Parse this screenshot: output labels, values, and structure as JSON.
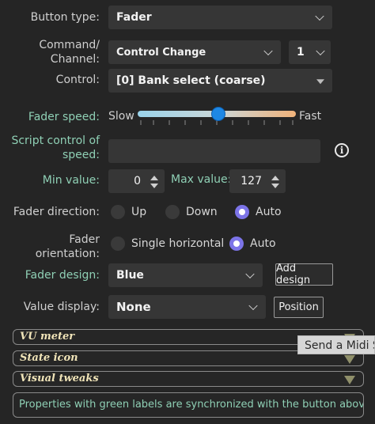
{
  "button_type": {
    "label": "Button type:",
    "value": "Fader"
  },
  "command_channel": {
    "label_line1": "Command/",
    "label_line2": "Channel:",
    "command": "Control Change",
    "channel": "1"
  },
  "control": {
    "label": "Control:",
    "value": "[0] Bank select (coarse)"
  },
  "fader_speed": {
    "label": "Fader speed:",
    "slow": "Slow",
    "fast": "Fast",
    "level": 0.51
  },
  "script_control": {
    "label_line1": "Script control of",
    "label_line2": "speed:",
    "value": "",
    "info_icon": "info-icon"
  },
  "min_value": {
    "label": "Min value:",
    "value": "0"
  },
  "max_value": {
    "label": "Max value:",
    "value": "127"
  },
  "fader_direction": {
    "label": "Fader direction:",
    "options": [
      "Up",
      "Down",
      "Auto"
    ],
    "selected": "Auto"
  },
  "fader_orientation": {
    "label_line1": "Fader",
    "label_line2": "orientation:",
    "options": [
      "Single horizontal",
      "Auto"
    ],
    "selected": "Auto"
  },
  "fader_design": {
    "label": "Fader design:",
    "value": "Blue",
    "button": "Add design"
  },
  "value_display": {
    "label": "Value display:",
    "value": "None",
    "button": "Position"
  },
  "sections": [
    "VU meter",
    "State icon",
    "Visual tweaks"
  ],
  "tooltip": "Send a Midi Sh",
  "note": "Properties with green labels are synchronized with the button above.",
  "colors": {
    "green_label": "#8fd0b5",
    "radio_selected": "#7c74e8",
    "slider_thumb": "#1e88e5",
    "section_title": "#f0e4b8"
  }
}
